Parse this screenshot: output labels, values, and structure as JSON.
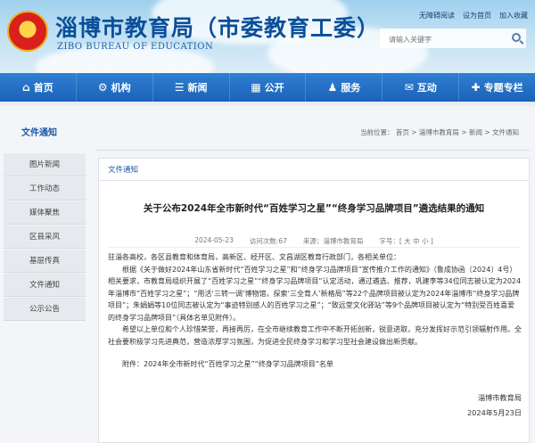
{
  "header": {
    "title": "淄博市教育局（市委教育工委）",
    "subtitle": "ZIBO BUREAU OF EDUCATION",
    "top_links": [
      "无障碍阅读",
      "设为首页",
      "加入收藏"
    ],
    "search_placeholder": "请输入关键字"
  },
  "nav": [
    {
      "icon": "home-icon",
      "glyph": "⌂",
      "label": "首页"
    },
    {
      "icon": "institution-icon",
      "glyph": "⚙",
      "label": "机构"
    },
    {
      "icon": "news-icon",
      "glyph": "☰",
      "label": "新闻"
    },
    {
      "icon": "open-icon",
      "glyph": "▦",
      "label": "公开"
    },
    {
      "icon": "service-icon",
      "glyph": "♟",
      "label": "服务"
    },
    {
      "icon": "interact-icon",
      "glyph": "✉",
      "label": "互动"
    },
    {
      "icon": "topic-icon",
      "glyph": "✚",
      "label": "专题专栏"
    }
  ],
  "sidebar": {
    "title": "文件通知",
    "items": [
      "图片新闻",
      "工作动态",
      "媒体聚焦",
      "区县采风",
      "基层传真",
      "文件通知",
      "公示公告"
    ]
  },
  "breadcrumb": "当前位置： 首页 > 淄博市教育局 > 新闻 > 文件通知",
  "article": {
    "tab": "文件通知",
    "title": "关于公布2024年全市新时代“百姓学习之星”“终身学习品牌项目”遴选结果的通知",
    "date": "2024-05-23",
    "views": "访问次数:67",
    "source": "来源：淄博市教育局",
    "font_size": "字号：[ 大 中 小 ]",
    "salutation": "驻淄各高校，各区县教育和体育局，高新区、经开区、文昌湖区教育行政部门，各相关单位：",
    "paragraph1": "根据《关于做好2024年山东省新时代“百姓学习之星”和“终身学习品牌项目”宣传推介工作的通知》（鲁成协函〔2024〕4号）相关要求，市教育局组织开展了“百姓学习之星”“终身学习品牌项目”认定活动，通过遴选、推荐，巩建李等34位同志被认定为2024年淄博市“百姓学习之星”；“用活‘三转一调’博物馆，探索‘三全育人’新格局”等22个品牌项目被认定为2024年淄博市“终身学习品牌项目”；朱娟娟等10位同志被认定为“事迹特别感人的百姓学习之星”；“致远堂文化驿站”等9个品牌项目被认定为“特别受百姓喜爱的终身学习品牌项目”（具体名单见附件）。",
    "paragraph2": "希望以上单位和个人珍惜荣誉，再接再厉，在全市继续教育工作中不断开拓创新，锐意进取，充分发挥好示范引领辐射作用。全社会要积极学习先进典范，营造浓厚学习氛围，为促进全民终身学习和学习型社会建设做出新贡献。",
    "attachment": "附件：2024年全市新时代“百姓学习之星”“终身学习品牌项目”名单",
    "signature": "淄博市教育局",
    "sign_date": "2024年5月23日"
  }
}
